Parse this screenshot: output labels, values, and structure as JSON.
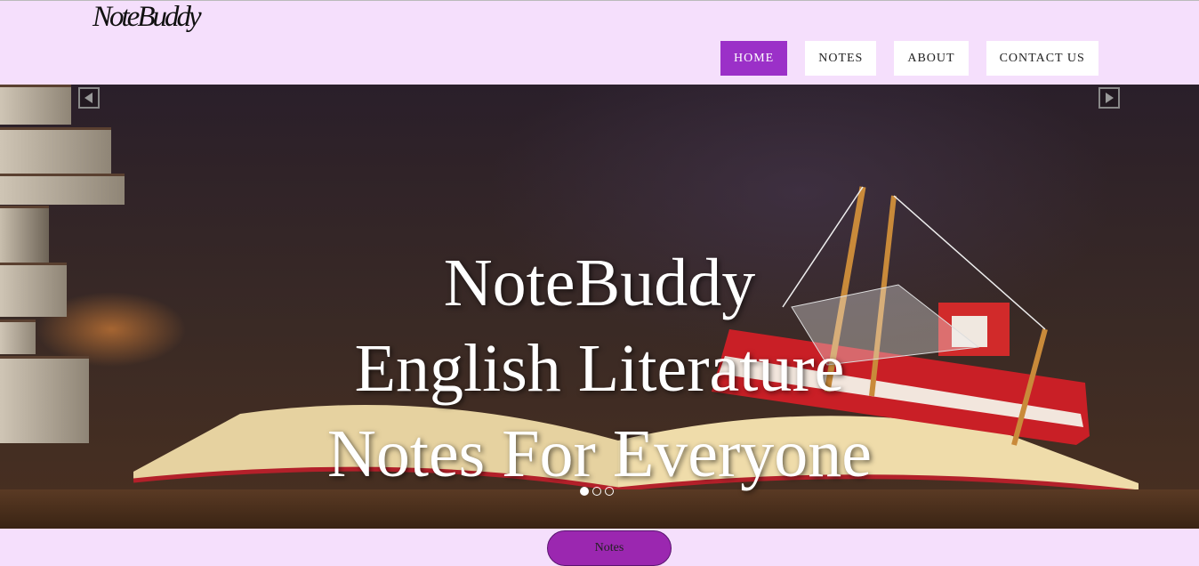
{
  "header": {
    "logo": "NoteBuddy",
    "nav": [
      {
        "label": "HOME",
        "active": true
      },
      {
        "label": "NOTES",
        "active": false
      },
      {
        "label": "ABOUT",
        "active": false
      },
      {
        "label": "CONTACT US",
        "active": false
      }
    ]
  },
  "hero": {
    "lines": [
      "NoteBuddy",
      "English Literature",
      "Notes For Everyone"
    ],
    "slide_count": 3,
    "active_slide": 1
  },
  "cta": {
    "label": "Notes"
  },
  "colors": {
    "page_bg": "#f5dffc",
    "accent": "#9b30c8"
  }
}
